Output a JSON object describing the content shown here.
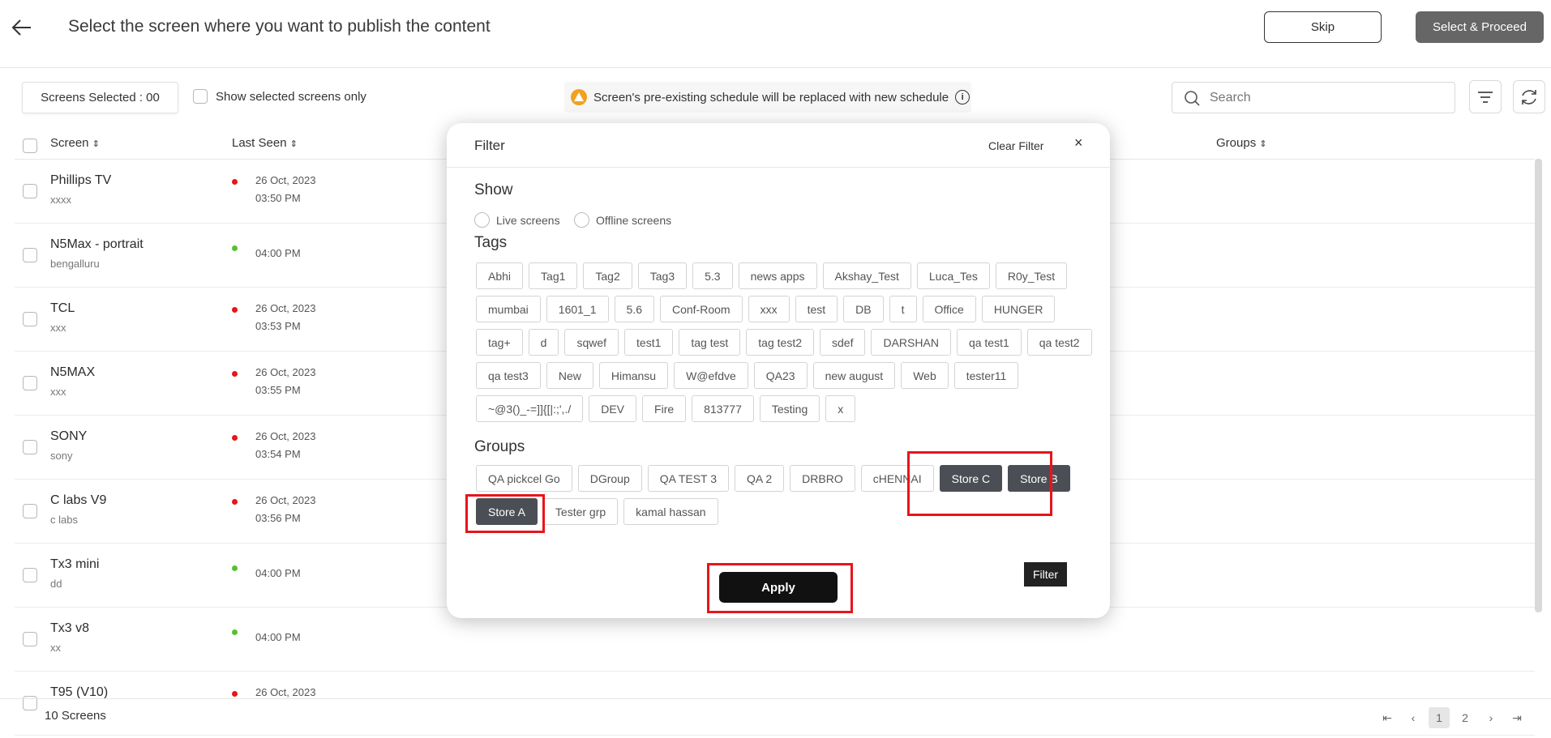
{
  "header": {
    "title": "Select the screen where you want to publish the content",
    "skip_label": "Skip",
    "proceed_label": "Select & Proceed"
  },
  "toolbar": {
    "screens_selected": "Screens Selected : 00",
    "show_selected_label": "Show selected screens only",
    "warning_text": "Screen's pre-existing schedule will be replaced with new schedule",
    "search_placeholder": "Search"
  },
  "table": {
    "headers": {
      "screen": "Screen",
      "last_seen": "Last Seen",
      "groups": "Groups"
    },
    "rows": [
      {
        "name": "Phillips TV",
        "sub": "xxxx",
        "status": "offline",
        "date": "26 Oct, 2023",
        "time": "03:50 PM"
      },
      {
        "name": "N5Max - portrait",
        "sub": "bengalluru",
        "status": "online",
        "date": "",
        "time": "04:00 PM"
      },
      {
        "name": "TCL",
        "sub": "xxx",
        "status": "offline",
        "date": "26 Oct, 2023",
        "time": "03:53 PM"
      },
      {
        "name": "N5MAX",
        "sub": "xxx",
        "status": "offline",
        "date": "26 Oct, 2023",
        "time": "03:55 PM"
      },
      {
        "name": "SONY",
        "sub": "sony",
        "status": "offline",
        "date": "26 Oct, 2023",
        "time": "03:54 PM"
      },
      {
        "name": "C labs V9",
        "sub": "c labs",
        "status": "offline",
        "date": "26 Oct, 2023",
        "time": "03:56 PM"
      },
      {
        "name": "Tx3 mini",
        "sub": "dd",
        "status": "online",
        "date": "",
        "time": "04:00 PM"
      },
      {
        "name": "Tx3 v8",
        "sub": "xx",
        "status": "online",
        "date": "",
        "time": "04:00 PM"
      },
      {
        "name": "T95 (V10)",
        "sub": "",
        "status": "offline",
        "date": "26 Oct, 2023",
        "time": ""
      }
    ]
  },
  "footer": {
    "count": "10 Screens",
    "pages": [
      "1",
      "2"
    ],
    "current_page": "1"
  },
  "filter": {
    "title": "Filter",
    "clear_label": "Clear Filter",
    "close_glyph": "×",
    "show_label": "Show",
    "live_label": "Live screens",
    "offline_label": "Offline screens",
    "tags_label": "Tags",
    "tags": [
      "Abhi",
      "Tag1",
      "Tag2",
      "Tag3",
      "5.3",
      "news apps",
      "Akshay_Test",
      "Luca_Tes",
      "R0y_Test",
      "mumbai",
      "1601_1",
      "5.6",
      "Conf-Room",
      "xxx",
      "test",
      "DB",
      "t",
      "Office",
      "HUNGER",
      "tag+",
      "d",
      "sqwef",
      "test1",
      "tag test",
      "tag test2",
      "sdef",
      "DARSHAN",
      "qa test1",
      "qa test2",
      "qa test3",
      "New",
      "Himansu",
      "W@efdve",
      "QA23",
      "new august",
      "Web",
      "tester11",
      "~@3()_-=]]{[|:;',./",
      "DEV",
      "Fire",
      "813777",
      "Testing",
      "x"
    ],
    "groups_label": "Groups",
    "groups": [
      {
        "label": "QA pickcel Go",
        "selected": false
      },
      {
        "label": "DGroup",
        "selected": false
      },
      {
        "label": "QA TEST 3",
        "selected": false
      },
      {
        "label": "QA 2",
        "selected": false
      },
      {
        "label": "DRBRO",
        "selected": false
      },
      {
        "label": "cHENNAI",
        "selected": false
      },
      {
        "label": "Store C",
        "selected": true
      },
      {
        "label": "Store B",
        "selected": true
      },
      {
        "label": "Store A",
        "selected": true
      },
      {
        "label": "Tester grp",
        "selected": false
      },
      {
        "label": "kamal hassan",
        "selected": false
      }
    ],
    "apply_label": "Apply",
    "tooltip": "Filter"
  },
  "colors": {
    "offline": "#e8141c",
    "online": "#55c12f",
    "selected_chip": "#4b4f55",
    "highlight": "#e8141c"
  },
  "icons": [
    "back-arrow-icon",
    "warning-icon",
    "info-icon",
    "search-icon",
    "filter-icon",
    "refresh-icon",
    "sort-icon",
    "first-page-icon",
    "prev-page-icon",
    "next-page-icon",
    "last-page-icon"
  ]
}
